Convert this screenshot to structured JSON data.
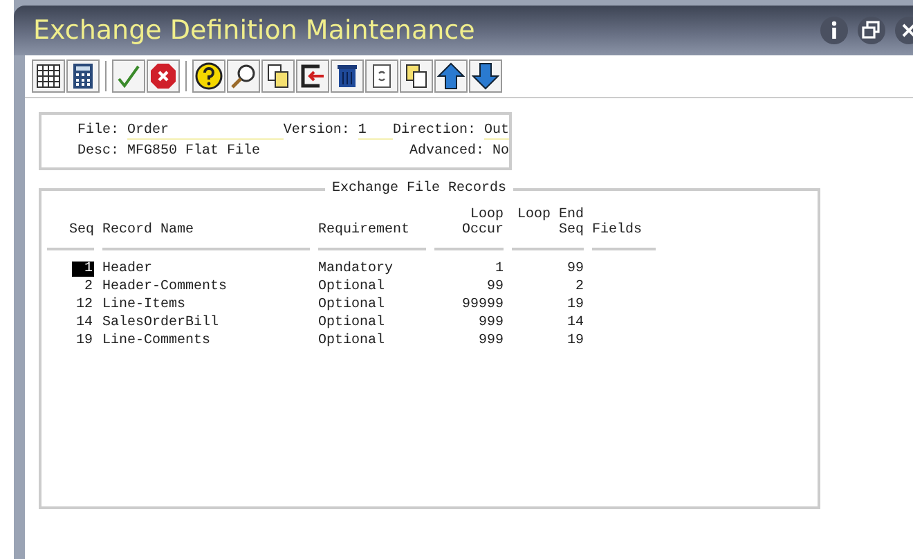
{
  "window": {
    "title": "Exchange Definition Maintenance"
  },
  "header": {
    "fields": [
      {
        "label": "File:",
        "value": "Order"
      },
      {
        "label": "Version:",
        "value": "1"
      },
      {
        "label": "Direction:",
        "value": "Out"
      },
      {
        "label": "Desc:",
        "value": "MFG850 Flat File"
      },
      {
        "label": "Advanced:",
        "value": "No"
      }
    ]
  },
  "records": {
    "title": "Exchange File Records",
    "columns": [
      {
        "bottom": "Seq"
      },
      {
        "bottom": "Record Name"
      },
      {
        "bottom": "Requirement"
      },
      {
        "top": "Loop",
        "bottom": "Occur"
      },
      {
        "top": "Loop End",
        "bottom": "Seq"
      },
      {
        "bottom": "Fields"
      }
    ],
    "rows": [
      {
        "seq": "1",
        "name": "Header",
        "requirement": "Mandatory",
        "occur": "1",
        "end_seq": "99",
        "selected": true
      },
      {
        "seq": "2",
        "name": "Header-Comments",
        "requirement": "Optional",
        "occur": "99",
        "end_seq": "2",
        "selected": false
      },
      {
        "seq": "12",
        "name": "Line-Items",
        "requirement": "Optional",
        "occur": "99999",
        "end_seq": "19",
        "selected": false
      },
      {
        "seq": "14",
        "name": "SalesOrderBill",
        "requirement": "Optional",
        "occur": "999",
        "end_seq": "14",
        "selected": false
      },
      {
        "seq": "19",
        "name": "Line-Comments",
        "requirement": "Optional",
        "occur": "999",
        "end_seq": "19",
        "selected": false
      }
    ]
  }
}
